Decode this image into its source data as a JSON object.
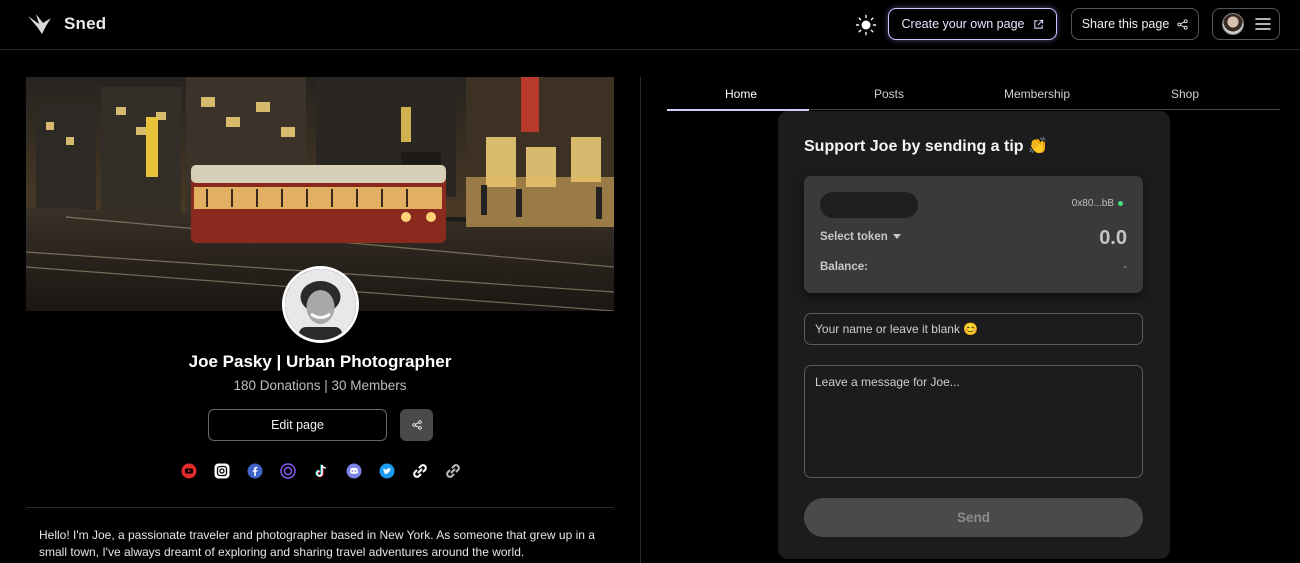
{
  "app": {
    "name": "Sned"
  },
  "header": {
    "create_label": "Create your own page",
    "share_label": "Share this page"
  },
  "profile": {
    "name": "Joe Pasky | Urban Photographer",
    "stats": "180 Donations | 30 Members",
    "edit_label": "Edit page",
    "bio": "Hello! I'm Joe, a passionate traveler and photographer based in New York. As someone that grew up in a small town, I've always dreamt of exploring and sharing travel adventures around the world."
  },
  "socials": [
    "youtube-icon",
    "instagram-icon",
    "facebook-icon",
    "twitch-icon",
    "tiktok-icon",
    "discord-icon",
    "twitter-icon",
    "link-icon",
    "link-alt-icon"
  ],
  "tabs": [
    {
      "label": "Home",
      "active": true
    },
    {
      "label": "Posts",
      "active": false
    },
    {
      "label": "Membership",
      "active": false
    },
    {
      "label": "Shop",
      "active": false
    }
  ],
  "tip": {
    "title": "Support Joe by sending a tip 👏",
    "address": "0x80...bB",
    "select_token": "Select token",
    "amount": "0.0",
    "balance_label": "Balance:",
    "balance_value": "-",
    "name_placeholder": "Your name or leave it blank 😊",
    "message_placeholder": "Leave a message for Joe...",
    "send_label": "Send"
  },
  "colors": {
    "accent": "#cfcbff",
    "status_green": "#4ade80",
    "card_bg": "#1c1c1e"
  }
}
